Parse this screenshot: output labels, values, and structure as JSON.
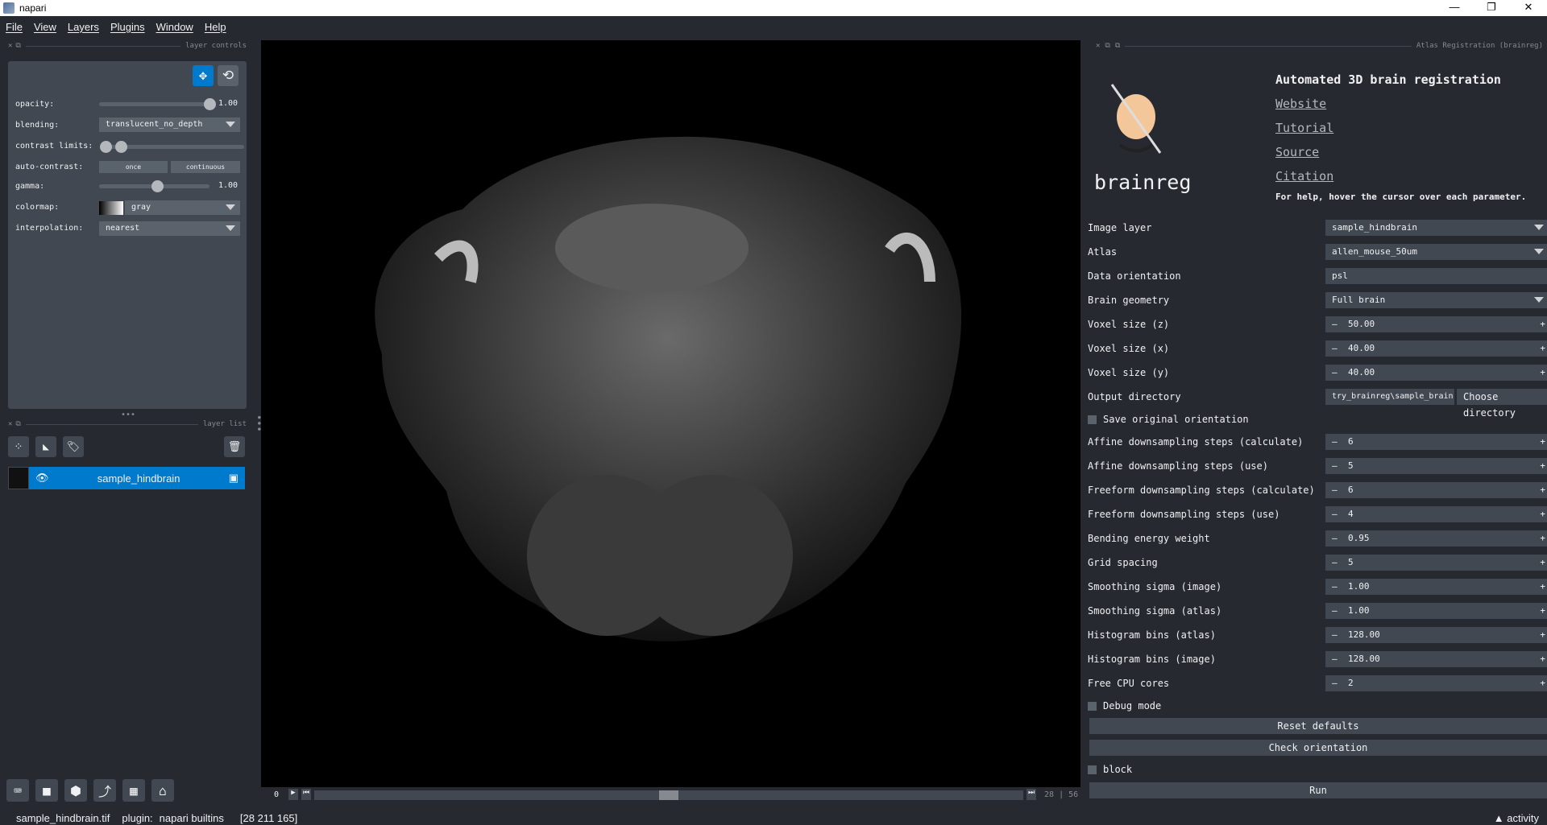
{
  "window": {
    "title": "napari",
    "controls": [
      "—",
      "❐",
      "✕"
    ]
  },
  "menu": [
    "File",
    "View",
    "Layers",
    "Plugins",
    "Window",
    "Help"
  ],
  "layer_controls": {
    "header": "layer controls",
    "opacity_label": "opacity:",
    "opacity_value": "1.00",
    "opacity_fraction": 1.0,
    "blending_label": "blending:",
    "blending_value": "translucent_no_depth",
    "contrast_label": "contrast limits:",
    "autocontrast_label": "auto-contrast:",
    "once": "once",
    "continuous": "continuous",
    "gamma_label": "gamma:",
    "gamma_value": "1.00",
    "gamma_fraction": 0.5,
    "colormap_label": "colormap:",
    "colormap_value": "gray",
    "interpolation_label": "interpolation:",
    "interpolation_value": "nearest",
    "accent": "#007acc"
  },
  "layer_list": {
    "header": "layer list",
    "layers": [
      {
        "name": "sample_hindbrain",
        "visible": true
      }
    ]
  },
  "slicer": {
    "current": "0",
    "position": "28",
    "total": "56",
    "fraction": 0.5
  },
  "statusbar": {
    "file": "sample_hindbrain.tif",
    "plugin_label": "plugin:",
    "plugin": "napari builtins",
    "coords": "[28 211 165]",
    "activity": "▲ activity"
  },
  "plugin": {
    "header": "Atlas Registration (brainreg)",
    "title": "Automated 3D brain registration",
    "logo_text": "brainreg",
    "links": [
      "Website",
      "Tutorial",
      "Source",
      "Citation"
    ],
    "help": "For help, hover the cursor over each parameter.",
    "fields": [
      {
        "label": "Image layer",
        "value": "sample_hindbrain",
        "kind": "combo"
      },
      {
        "label": "Atlas",
        "value": "allen_mouse_50um",
        "kind": "combo"
      },
      {
        "label": "Data orientation",
        "value": "psl",
        "kind": "text"
      },
      {
        "label": "Brain geometry",
        "value": "Full brain",
        "kind": "combo"
      },
      {
        "label": "Voxel size (z)",
        "value": "50.00",
        "kind": "spin"
      },
      {
        "label": "Voxel size (x)",
        "value": "40.00",
        "kind": "spin"
      },
      {
        "label": "Voxel size (y)",
        "value": "40.00",
        "kind": "spin"
      }
    ],
    "output_label": "Output directory",
    "output_value": "try_brainreg\\sample_brain",
    "choose_dir": "Choose directory",
    "save_orientation": "Save original orientation",
    "fields2": [
      {
        "label": "Affine downsampling steps (calculate)",
        "value": "6"
      },
      {
        "label": "Affine downsampling steps (use)",
        "value": "5"
      },
      {
        "label": "Freeform downsampling steps (calculate)",
        "value": "6"
      },
      {
        "label": "Freeform downsampling steps (use)",
        "value": "4"
      },
      {
        "label": "Bending energy weight",
        "value": "0.95"
      },
      {
        "label": "Grid spacing",
        "value": "5"
      },
      {
        "label": "Smoothing sigma (image)",
        "value": "1.00"
      },
      {
        "label": "Smoothing sigma (atlas)",
        "value": "1.00"
      },
      {
        "label": "Histogram bins (atlas)",
        "value": "128.00"
      },
      {
        "label": "Histogram bins (image)",
        "value": "128.00"
      },
      {
        "label": "Free CPU cores",
        "value": "2"
      }
    ],
    "debug_mode": "Debug mode",
    "reset_defaults": "Reset defaults",
    "check_orientation": "Check orientation",
    "block": "block",
    "run": "Run"
  }
}
